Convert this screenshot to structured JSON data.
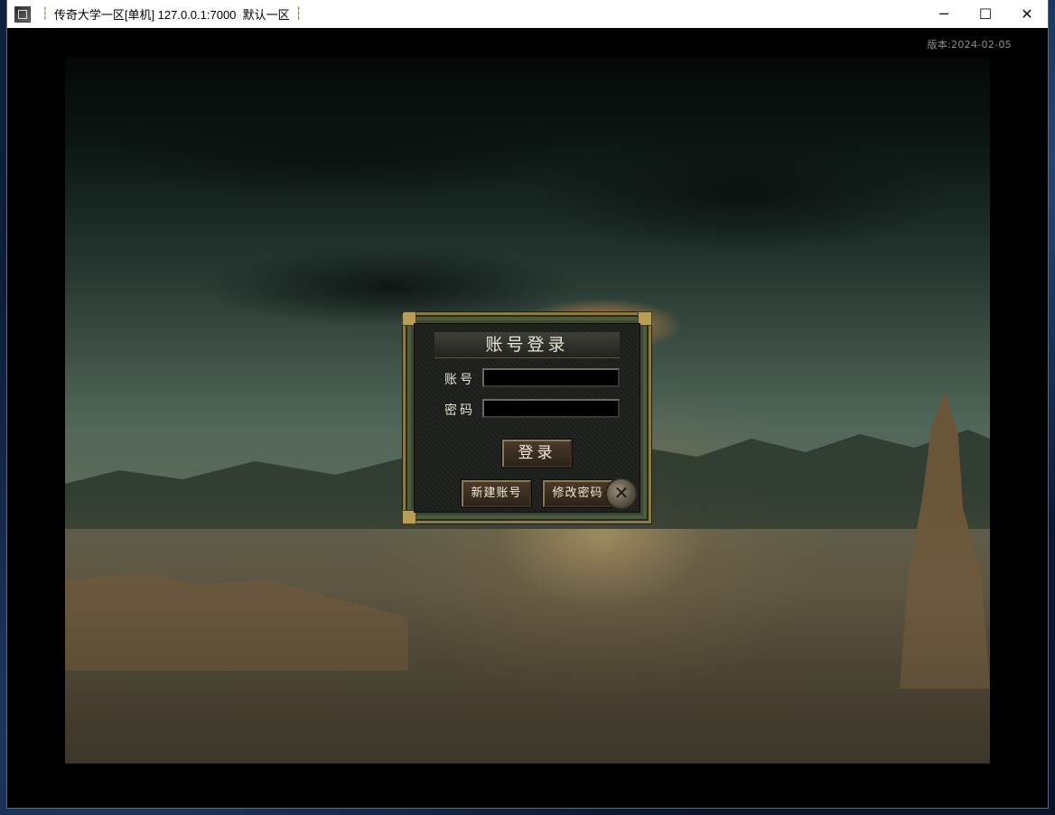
{
  "window": {
    "title": "传奇大学一区[单机] 127.0.0.1:7000  默认一区",
    "title_sep_left": "┆",
    "title_sep_right": "┆",
    "controls": {
      "minimize": "─",
      "maximize": "☐",
      "close": "✕"
    }
  },
  "client": {
    "version": "版本:2024-02-05"
  },
  "login_dialog": {
    "title": "账号登录",
    "account_label": "账号",
    "account_value": "",
    "password_label": "密码",
    "password_value": "",
    "login_button": "登录",
    "new_account_button": "新建账号",
    "change_password_button": "修改密码",
    "close_button": "✕"
  },
  "colors": {
    "titlebar_bg": "#ffffff",
    "client_bg": "#000000",
    "dialog_border": "#8a7a46",
    "dialog_bg": "#1d1f1c",
    "button_bg": "#3a2d20"
  },
  "icons": [
    "app-icon",
    "minimize-icon",
    "maximize-icon",
    "close-icon",
    "dialog-close-icon"
  ]
}
